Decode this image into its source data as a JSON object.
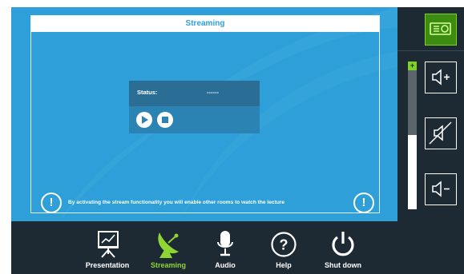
{
  "panel": {
    "title": "Streaming",
    "status_label": "Status:",
    "status_value": "------",
    "info_text": "By activating the stream functionality you will enable other rooms to watch the lecture"
  },
  "sidebar": {
    "volume_plus": "+",
    "volume_level": 0.5,
    "buttons": [
      "projector-icon",
      "volume-up-icon",
      "mute-icon",
      "volume-down-icon"
    ]
  },
  "nav": {
    "items": [
      {
        "label": "Presentation",
        "icon": "presentation-icon"
      },
      {
        "label": "Streaming",
        "icon": "satellite-dish-icon",
        "active": true
      },
      {
        "label": "Audio",
        "icon": "microphone-icon"
      },
      {
        "label": "Help",
        "icon": "help-icon"
      },
      {
        "label": "Shut down",
        "icon": "power-icon"
      }
    ]
  },
  "colors": {
    "main_blue": "#2e9fd8",
    "dark": "#1e2a33",
    "accent_green": "#8fd632"
  }
}
